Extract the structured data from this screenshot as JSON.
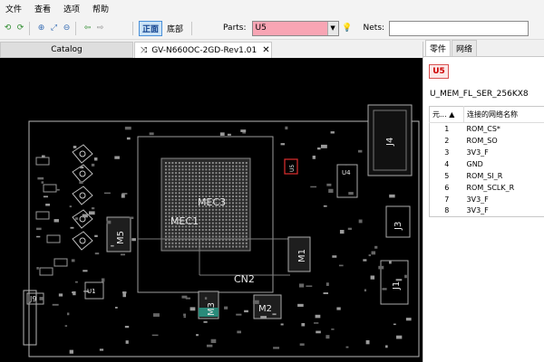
{
  "menu": [
    "文件",
    "查看",
    "选项",
    "帮助"
  ],
  "toolbar": {
    "view_front": "正面",
    "view_bottom": "底部",
    "parts_label": "Parts:",
    "parts_value": "U5",
    "nets_label": "Nets:",
    "nets_value": ""
  },
  "tabs": {
    "catalog": "Catalog",
    "document": "GV-N660OC-2GD-Rev1.01"
  },
  "right_panel": {
    "tabs": [
      "零件",
      "网络"
    ],
    "part_name": "U5",
    "part_desc": "U_MEM_FL_SER_256KX8",
    "table_headers": [
      "元...",
      "连接的网络名称"
    ],
    "pins": [
      {
        "pin": "1",
        "net": "ROM_CS*"
      },
      {
        "pin": "2",
        "net": "ROM_SO"
      },
      {
        "pin": "3",
        "net": "3V3_F"
      },
      {
        "pin": "4",
        "net": "GND"
      },
      {
        "pin": "5",
        "net": "ROM_SI_R"
      },
      {
        "pin": "6",
        "net": "ROM_SCLK_R"
      },
      {
        "pin": "7",
        "net": "3V3_F"
      },
      {
        "pin": "8",
        "net": "3V3_F"
      }
    ]
  },
  "board": {
    "labels": [
      "MEC3",
      "MEC1",
      "CN2",
      "M1",
      "M2",
      "M3",
      "M5",
      "J1",
      "J3",
      "J4",
      "J9",
      "U1",
      "U4",
      "U5"
    ]
  }
}
